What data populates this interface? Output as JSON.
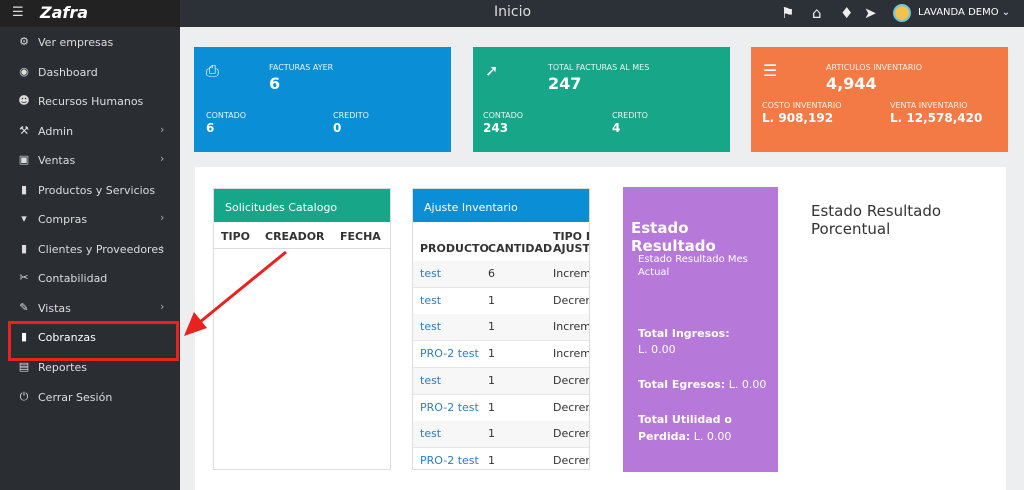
{
  "topbar": {
    "logo": "Zafra",
    "title": "Inicio",
    "user": "LAVANDA DEMO ⌄",
    "icons": [
      "menu-icon",
      "tags-icon",
      "home-icon",
      "bell-icon",
      "paper-plane-icon"
    ]
  },
  "sidebar": {
    "items": [
      {
        "label": "Ver empresas",
        "icon": "cogs-icon",
        "chevron": false
      },
      {
        "label": "Dashboard",
        "icon": "dashboard-icon",
        "chevron": false
      },
      {
        "label": "Recursos Humanos",
        "icon": "user-icon",
        "chevron": false
      },
      {
        "label": "Admin",
        "icon": "wrench-icon",
        "chevron": true
      },
      {
        "label": "Ventas",
        "icon": "money-icon",
        "chevron": true
      },
      {
        "label": "Productos y Servicios",
        "icon": "book-icon",
        "chevron": false
      },
      {
        "label": "Compras",
        "icon": "cart-icon",
        "chevron": true
      },
      {
        "label": "Clientes y Proveedores",
        "icon": "book-icon",
        "chevron": true
      },
      {
        "label": "Contabilidad",
        "icon": "link-icon",
        "chevron": false
      },
      {
        "label": "Vistas",
        "icon": "edit-icon",
        "chevron": true
      },
      {
        "label": "Cobranzas",
        "icon": "book-icon",
        "chevron": false
      },
      {
        "label": "Reportes",
        "icon": "clipboard-icon",
        "chevron": false
      },
      {
        "label": "Cerrar Sesión",
        "icon": "power-icon",
        "chevron": false
      }
    ]
  },
  "cards": {
    "facturas": {
      "title": "FACTURAS AYER",
      "value": "6",
      "contado_label": "CONTADO",
      "contado": "6",
      "credito_label": "CREDITO",
      "credito": "0",
      "color": "#0a8fd6"
    },
    "total": {
      "title": "TOTAL FACTURAS AL MES",
      "value": "247",
      "contado_label": "CONTADO",
      "contado": "243",
      "credito_label": "CREDITO",
      "credito": "4",
      "color": "#18a689"
    },
    "articulos": {
      "title": "ARTICULOS INVENTARIO",
      "value": "4,944",
      "costo_label": "COSTO INVENTARIO",
      "costo": "L. 908,192",
      "venta_label": "VENTA INVENTARIO",
      "venta": "L. 12,578,420",
      "color": "#f47a45"
    }
  },
  "solicitudes": {
    "title": "Solicitudes Catalogo",
    "headers": [
      "TIPO",
      "CREADOR",
      "FECHA"
    ]
  },
  "ajuste": {
    "title": "Ajuste Inventario",
    "headers": [
      "PRODUCTO",
      "CANTIDAD",
      "TIPO DE",
      "AJUSTE"
    ],
    "rows": [
      {
        "producto": "test",
        "cantidad": "6",
        "tipo": "Increme"
      },
      {
        "producto": "test",
        "cantidad": "1",
        "tipo": "Decreme"
      },
      {
        "producto": "test",
        "cantidad": "1",
        "tipo": "Increme"
      },
      {
        "producto": "PRO-2 test",
        "cantidad": "1",
        "tipo": "Increme"
      },
      {
        "producto": "test",
        "cantidad": "1",
        "tipo": "Decreme"
      },
      {
        "producto": "PRO-2 test",
        "cantidad": "1",
        "tipo": "Decreme"
      },
      {
        "producto": "test",
        "cantidad": "1",
        "tipo": "Decreme"
      },
      {
        "producto": "PRO-2 test",
        "cantidad": "1",
        "tipo": "Decreme"
      }
    ]
  },
  "estado": {
    "title": "Estado Resultado",
    "subtitle": "Estado Resultado Mes Actual",
    "ingresos_label": "Total Ingresos:",
    "ingresos": "L. 0.00",
    "egresos_label": "Total Egresos:",
    "egresos": "L. 0.00",
    "utilidad_label1": "Total Utilidad o",
    "utilidad_label2": "Perdida:",
    "utilidad": "L. 0.00",
    "color": "#b679d9"
  },
  "porcentual": {
    "title": "Estado Resultado Porcentual"
  }
}
